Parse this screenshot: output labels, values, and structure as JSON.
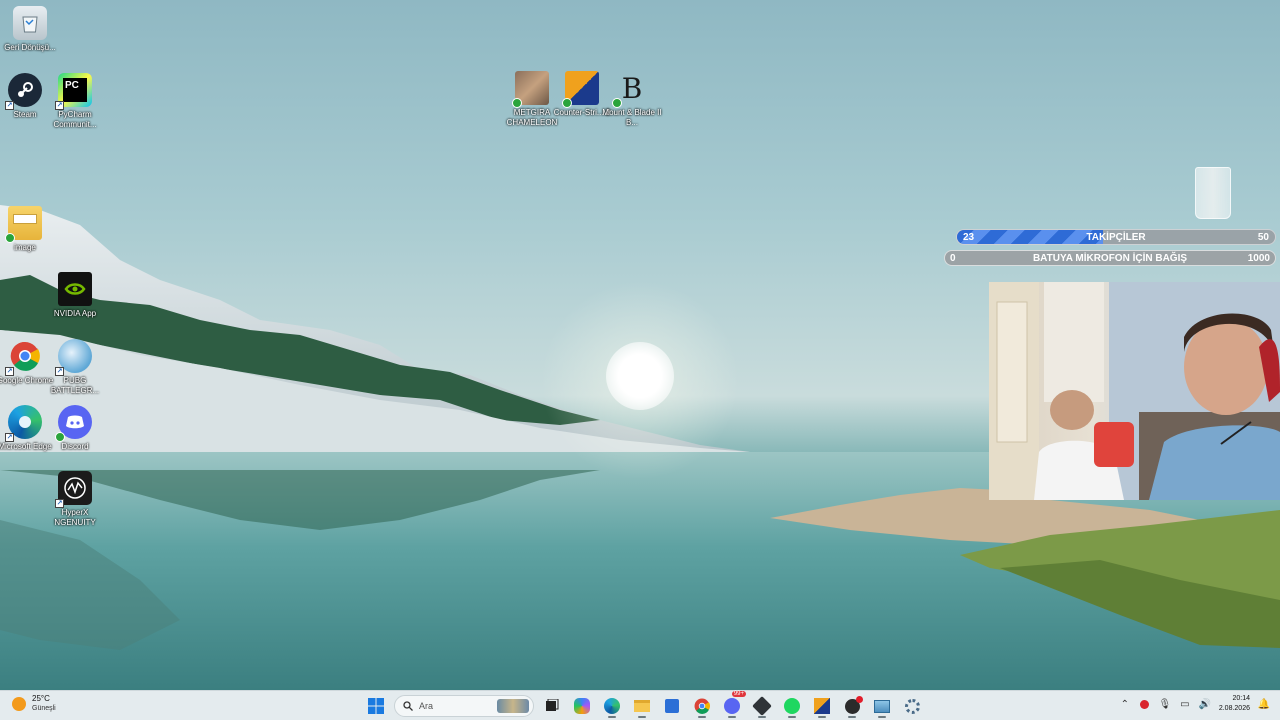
{
  "desktop_icons": {
    "recycle_bin": "Geri Dönüşü...",
    "steam": "Steam",
    "pycharm": "PyCharm Communit...",
    "image": "image",
    "nvidia": "NVIDIA App",
    "chrome": "Google Chrome",
    "pubg": "PUBG BATTLEGR...",
    "edge": "Microsoft Edge",
    "discord": "Discord",
    "hyperx": "HyperX NGENUITY",
    "metgira": "METGIRA CHAMELEON",
    "counter_strike": "Counter-Stri... 2",
    "mount_blade": "Mount & Blade II B..."
  },
  "overlays": {
    "followers": {
      "current": "23",
      "label": "TAKİPÇİLER",
      "goal": "50",
      "progress": 0.46
    },
    "donation": {
      "current": "0",
      "label": "BATUYA MİKROFON İÇİN BAĞIŞ",
      "goal": "1000",
      "progress": 0
    }
  },
  "taskbar": {
    "weather": {
      "temp": "25°C",
      "condition": "Güneşli"
    },
    "search_placeholder": "Ara",
    "discord_badge": "99+",
    "clock": {
      "time": "20:14",
      "date": "2.08.2026"
    }
  },
  "colors": {
    "taskbar_bg": "#e4ebee",
    "follower_fill": "#2e6bd6",
    "weather_sun": "#f39a1b"
  }
}
